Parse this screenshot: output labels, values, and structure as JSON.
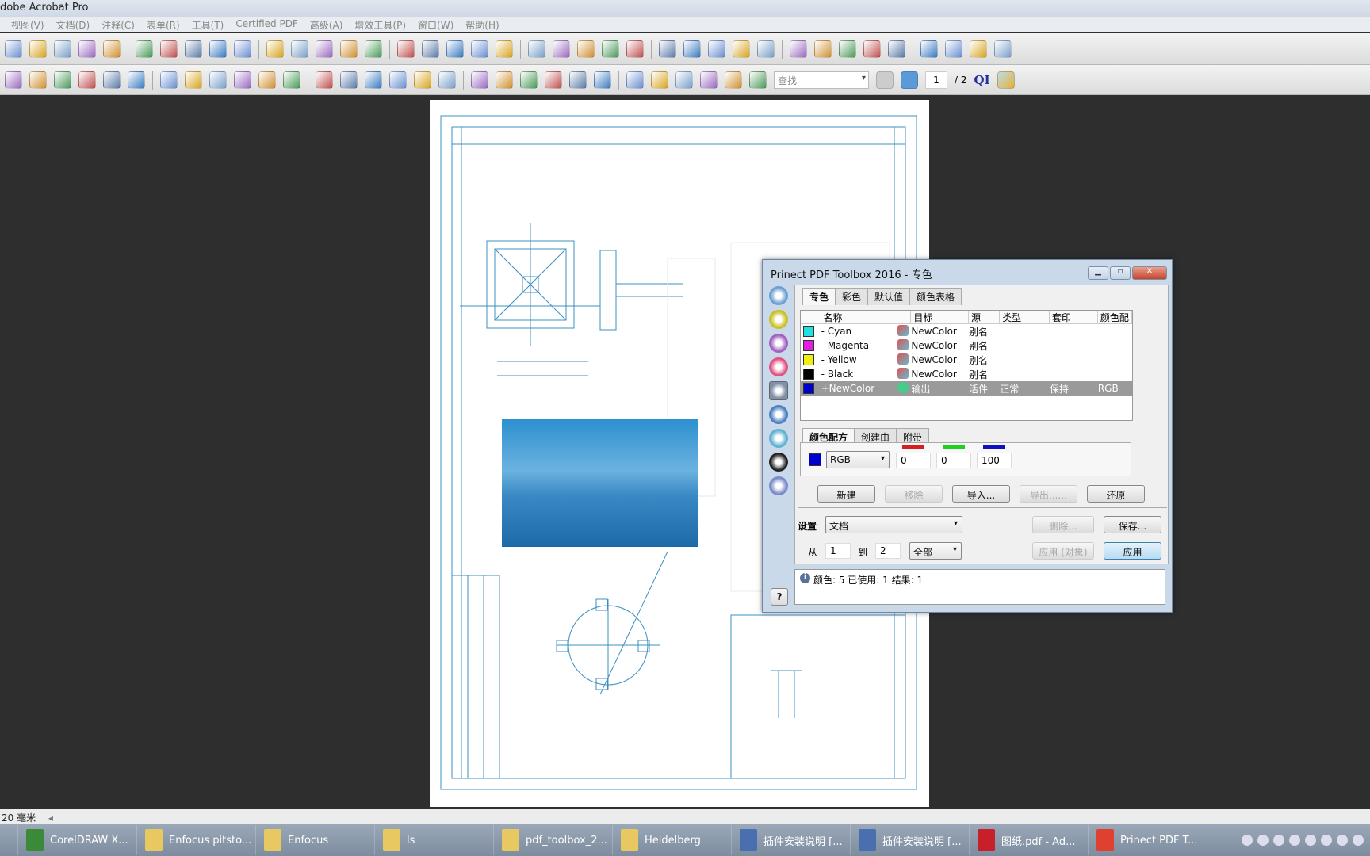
{
  "app": {
    "title": "dobe Acrobat Pro"
  },
  "menu": [
    "视图(V)",
    "文档(D)",
    "注释(C)",
    "表单(R)",
    "工具(T)",
    "Certified PDF",
    "高级(A)",
    "增效工具(P)",
    "窗口(W)",
    "帮助(H)"
  ],
  "toolbar": {
    "row1_icons": [
      "create-pdf-icon",
      "lock-icon",
      "sign-icon",
      "forms-icon",
      "collaborate-icon",
      "review-icon",
      "print-icon",
      "export-icon",
      "zoom-icon",
      "check-icon",
      "preflight-icon",
      "settings-icon",
      "filter-icon",
      "table-icon",
      "printer-icon",
      "output-icon",
      "camera-icon",
      "warning-icon",
      "select-icon",
      "marquee-icon",
      "pan-icon",
      "text-icon",
      "font-icon",
      "touchup-icon",
      "pin-icon",
      "crop-icon",
      "grid-icon",
      "link-icon",
      "link2-icon",
      "bracket-icon",
      "page-icon",
      "layout-icon",
      "hash-icon",
      "hash2-icon",
      "stamp-icon",
      "comment-icon",
      "mail-icon",
      "pattern-icon",
      "stack-icon"
    ],
    "row2_icons": [
      "combine-icon",
      "attach-icon",
      "open-icon",
      "save-icon",
      "email-icon",
      "refresh-icon",
      "cut-icon",
      "transform-icon",
      "fit-icon",
      "fullscreen-icon",
      "edit-object-icon",
      "rotate-icon",
      "pencil-icon",
      "book-icon",
      "doc-icon",
      "edit-icon",
      "image-icon",
      "x-icon",
      "film-icon",
      "layers-icon",
      "search-doc-icon",
      "transparency-icon",
      "move-icon",
      "barcode-icon",
      "text-obj-icon",
      "frame-icon",
      "checker-icon",
      "cross-box-icon",
      "download-icon",
      "image-replace-icon"
    ],
    "find_placeholder": "查找",
    "page_current": "1",
    "page_total": "/ 2",
    "qi_label": "QI"
  },
  "status": {
    "measure": "20 毫米"
  },
  "taskbar": [
    {
      "label": "CorelDRAW X...",
      "color": "#3a8a3a"
    },
    {
      "label": "Enfocus pitsto...",
      "color": "#e8c860"
    },
    {
      "label": "Enfocus",
      "color": "#e8c860"
    },
    {
      "label": "ls",
      "color": "#e8c860"
    },
    {
      "label": "pdf_toolbox_2...",
      "color": "#e8c860"
    },
    {
      "label": "Heidelberg",
      "color": "#e8c860"
    },
    {
      "label": "插件安装说明 [...",
      "color": "#4a6fb0"
    },
    {
      "label": "插件安装说明 [...",
      "color": "#4a6fb0"
    },
    {
      "label": "图纸.pdf - Ad...",
      "color": "#c8202a"
    },
    {
      "label": "Prinect PDF T...",
      "color": "#e04030"
    }
  ],
  "dialog": {
    "title": "Prinect PDF Toolbox 2016 - 专色",
    "side_icons": [
      "fixups-icon",
      "check-icon",
      "edit-path-icon",
      "color-wheel-icon",
      "spot-colors-icon",
      "search-icon",
      "overprint-icon",
      "grid-icon",
      "annotate-icon"
    ],
    "tabs": [
      "专色",
      "彩色",
      "默认值",
      "颜色表格"
    ],
    "columns": [
      "名称",
      "目标",
      "源",
      "类型",
      "套印",
      "颜色配"
    ],
    "rows": [
      {
        "swatch": "#20e0e0",
        "name": "- Cyan",
        "target": "NewColor",
        "source": "别名",
        "type": "",
        "overprint": "",
        "color": ""
      },
      {
        "swatch": "#e020e0",
        "name": "- Magenta",
        "target": "NewColor",
        "source": "别名",
        "type": "",
        "overprint": "",
        "color": ""
      },
      {
        "swatch": "#f0f010",
        "name": "- Yellow",
        "target": "NewColor",
        "source": "别名",
        "type": "",
        "overprint": "",
        "color": ""
      },
      {
        "swatch": "#000000",
        "name": "- Black",
        "target": "NewColor",
        "source": "别名",
        "type": "",
        "overprint": "",
        "color": ""
      },
      {
        "swatch": "#0000cc",
        "name": "+NewColor",
        "target": "输出",
        "source": "活件",
        "type": "正常",
        "overprint": "保持",
        "color": "RGB",
        "selected": true
      }
    ],
    "recipe_tabs": [
      "颜色配方",
      "创建由",
      "附带"
    ],
    "recipe": {
      "swatch": "#0000cc",
      "model": "RGB",
      "values": [
        "0",
        "0",
        "100"
      ],
      "channel_colors": [
        "#d42020",
        "#20d020",
        "#1010c0"
      ]
    },
    "buttons": {
      "new": "新建",
      "remove": "移除",
      "import": "导入...",
      "export": "导出......",
      "restore": "还原",
      "delete": "删除...",
      "save": "保存...",
      "apply_object": "应用 (对象)",
      "apply": "应用",
      "help": "?"
    },
    "settings_label": "设置",
    "settings_value": "文档",
    "from_label": "从",
    "from_value": "1",
    "to_label": "到",
    "to_value": "2",
    "range_value": "全部",
    "info": "颜色: 5  已使用: 1  结果: 1"
  }
}
